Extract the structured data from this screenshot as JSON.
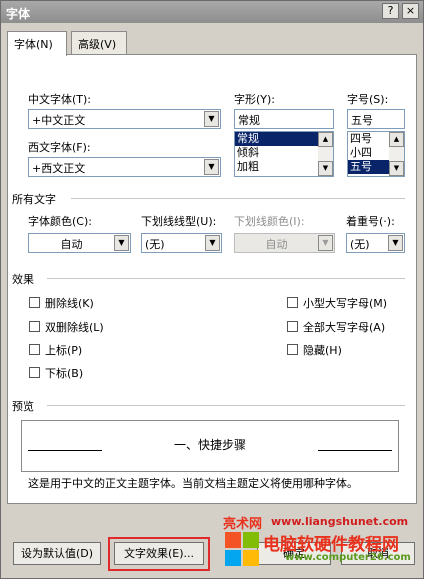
{
  "window": {
    "title": "字体",
    "help_button": "?",
    "close_button": "×"
  },
  "tabs": [
    {
      "label": "字体(N)",
      "active": true
    },
    {
      "label": "高级(V)",
      "active": false
    }
  ],
  "east_asian_font": {
    "label": "中文字体(T):",
    "value": "+中文正文"
  },
  "latin_font": {
    "label": "西文字体(F):",
    "value": "+西文正文"
  },
  "font_style": {
    "label": "字形(Y):",
    "value": "常规",
    "options": [
      "常规",
      "倾斜",
      "加粗"
    ],
    "selected": "常规"
  },
  "font_size": {
    "label": "字号(S):",
    "value": "五号",
    "options": [
      "四号",
      "小四",
      "五号"
    ],
    "selected": "五号"
  },
  "all_text": {
    "section": "所有文字",
    "font_color": {
      "label": "字体颜色(C):",
      "value": "自动"
    },
    "underline_style": {
      "label": "下划线线型(U):",
      "value": "(无)"
    },
    "underline_color": {
      "label": "下划线颜色(I):",
      "value": "自动",
      "disabled": true
    },
    "emphasis_mark": {
      "label": "着重号(·):",
      "value": "(无)"
    }
  },
  "effects": {
    "section": "效果",
    "options": [
      {
        "label": "删除线(K)",
        "checked": false
      },
      {
        "label": "双删除线(L)",
        "checked": false
      },
      {
        "label": "上标(P)",
        "checked": false
      },
      {
        "label": "下标(B)",
        "checked": false
      },
      {
        "label": "小型大写字母(M)",
        "checked": false
      },
      {
        "label": "全部大写字母(A)",
        "checked": false
      },
      {
        "label": "隐藏(H)",
        "checked": false
      }
    ]
  },
  "preview": {
    "section": "预览",
    "sample_text": "一、快捷步骤",
    "note": "这是用于中文的正文主题字体。当前文档主题定义将使用哪种字体。"
  },
  "buttons": {
    "set_default": "设为默认值(D)",
    "text_effects": "文字效果(E)...",
    "ok": "确定",
    "cancel": "取消"
  },
  "watermark": {
    "site_cn": "亮术网",
    "url1": "www.liangshunet.com",
    "title": "电脑软硬件教程网",
    "url2": "www.computer26.com"
  },
  "colors": {
    "highlight": "#0a246a",
    "callout_border": "#e0292a"
  }
}
